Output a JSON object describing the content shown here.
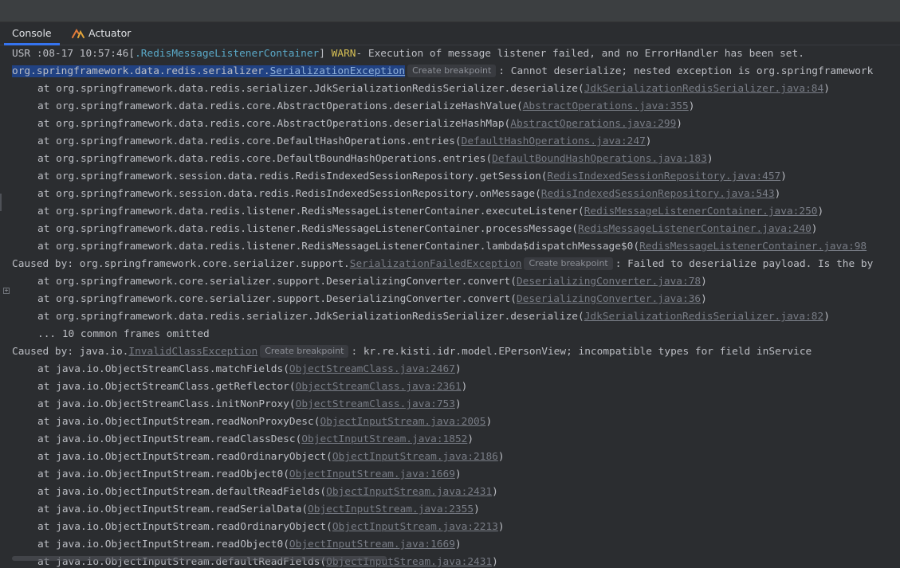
{
  "tabs": {
    "console": "Console",
    "actuator": "Actuator"
  },
  "breakpoint_label": "Create breakpoint",
  "header": {
    "prefix": "USR :08-17 10:57:46[",
    "thread": ".RedisMessageListenerContainer",
    "close": "] ",
    "level": "WARN",
    "message": "- Execution of message listener failed, and no ErrorHandler has been set."
  },
  "exception1": {
    "pkg": "org.springframework.data.redis.serializer.",
    "cls": "SerializationException",
    "msg": ": Cannot deserialize; nested exception is org.springframework"
  },
  "caused2": {
    "prefix": "Caused by: ",
    "pkg": "org.springframework.core.serializer.support.",
    "cls": "SerializationFailedException",
    "msg": ": Failed to deserialize payload. Is the by"
  },
  "caused3": {
    "prefix": "Caused by: ",
    "pkg": "java.io.",
    "cls": "InvalidClassException",
    "msg": ": kr.re.kisti.idr.model.EPersonView; incompatible types for field inService"
  },
  "omitted": "... 10 common frames omitted",
  "frames1": [
    {
      "m": "org.springframework.data.redis.serializer.JdkSerializationRedisSerializer.deserialize",
      "l": "JdkSerializationRedisSerializer.java:84",
      "tail": ")"
    },
    {
      "m": "org.springframework.data.redis.core.AbstractOperations.deserializeHashValue",
      "l": "AbstractOperations.java:355",
      "tail": ")"
    },
    {
      "m": "org.springframework.data.redis.core.AbstractOperations.deserializeHashMap",
      "l": "AbstractOperations.java:299",
      "tail": ")"
    },
    {
      "m": "org.springframework.data.redis.core.DefaultHashOperations.entries",
      "l": "DefaultHashOperations.java:247",
      "tail": ")"
    },
    {
      "m": "org.springframework.data.redis.core.DefaultBoundHashOperations.entries",
      "l": "DefaultBoundHashOperations.java:183",
      "tail": ")"
    },
    {
      "m": "org.springframework.session.data.redis.RedisIndexedSessionRepository.getSession",
      "l": "RedisIndexedSessionRepository.java:457",
      "tail": ")"
    },
    {
      "m": "org.springframework.session.data.redis.RedisIndexedSessionRepository.onMessage",
      "l": "RedisIndexedSessionRepository.java:543",
      "tail": ")"
    },
    {
      "m": "org.springframework.data.redis.listener.RedisMessageListenerContainer.executeListener",
      "l": "RedisMessageListenerContainer.java:250",
      "tail": ")"
    },
    {
      "m": "org.springframework.data.redis.listener.RedisMessageListenerContainer.processMessage",
      "l": "RedisMessageListenerContainer.java:240",
      "tail": ")"
    },
    {
      "m": "org.springframework.data.redis.listener.RedisMessageListenerContainer.lambda$dispatchMessage$0",
      "l": "RedisMessageListenerContainer.java:98",
      "tail": ""
    }
  ],
  "frames2": [
    {
      "m": "org.springframework.core.serializer.support.DeserializingConverter.convert",
      "l": "DeserializingConverter.java:78",
      "tail": ")"
    },
    {
      "m": "org.springframework.core.serializer.support.DeserializingConverter.convert",
      "l": "DeserializingConverter.java:36",
      "tail": ")"
    },
    {
      "m": "org.springframework.data.redis.serializer.JdkSerializationRedisSerializer.deserialize",
      "l": "JdkSerializationRedisSerializer.java:82",
      "tail": ")"
    }
  ],
  "frames3": [
    {
      "m": "java.io.ObjectStreamClass.matchFields",
      "l": "ObjectStreamClass.java:2467",
      "tail": ")"
    },
    {
      "m": "java.io.ObjectStreamClass.getReflector",
      "l": "ObjectStreamClass.java:2361",
      "tail": ")"
    },
    {
      "m": "java.io.ObjectStreamClass.initNonProxy",
      "l": "ObjectStreamClass.java:753",
      "tail": ")"
    },
    {
      "m": "java.io.ObjectInputStream.readNonProxyDesc",
      "l": "ObjectInputStream.java:2005",
      "tail": ")"
    },
    {
      "m": "java.io.ObjectInputStream.readClassDesc",
      "l": "ObjectInputStream.java:1852",
      "tail": ")"
    },
    {
      "m": "java.io.ObjectInputStream.readOrdinaryObject",
      "l": "ObjectInputStream.java:2186",
      "tail": ")"
    },
    {
      "m": "java.io.ObjectInputStream.readObject0",
      "l": "ObjectInputStream.java:1669",
      "tail": ")"
    },
    {
      "m": "java.io.ObjectInputStream.defaultReadFields",
      "l": "ObjectInputStream.java:2431",
      "tail": ")"
    },
    {
      "m": "java.io.ObjectInputStream.readSerialData",
      "l": "ObjectInputStream.java:2355",
      "tail": ")"
    },
    {
      "m": "java.io.ObjectInputStream.readOrdinaryObject",
      "l": "ObjectInputStream.java:2213",
      "tail": ")"
    },
    {
      "m": "java.io.ObjectInputStream.readObject0",
      "l": "ObjectInputStream.java:1669",
      "tail": ")"
    },
    {
      "m": "java.io.ObjectInputStream.defaultReadFields",
      "l": "ObjectInputStream.java:2431",
      "tail": ")"
    }
  ]
}
